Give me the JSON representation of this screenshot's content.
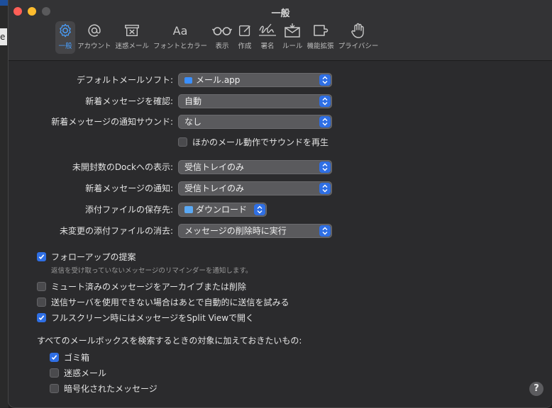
{
  "window": {
    "title": "一般"
  },
  "toolbar": {
    "tabs": [
      {
        "label": "一般",
        "icon": "gear-icon",
        "active": true
      },
      {
        "label": "アカウント",
        "icon": "at-icon"
      },
      {
        "label": "迷惑メール",
        "icon": "junk-icon"
      },
      {
        "label": "フォントとカラー",
        "icon": "font-icon"
      },
      {
        "label": "表示",
        "icon": "glasses-icon"
      },
      {
        "label": "作成",
        "icon": "compose-icon"
      },
      {
        "label": "署名",
        "icon": "signature-icon"
      },
      {
        "label": "ルール",
        "icon": "rules-icon"
      },
      {
        "label": "機能拡張",
        "icon": "extension-icon"
      },
      {
        "label": "プライバシー",
        "icon": "hand-icon"
      }
    ]
  },
  "settings": {
    "default_mail_app": {
      "label": "デフォルトメールソフト:",
      "value": "メール.app"
    },
    "check_new": {
      "label": "新着メッセージを確認:",
      "value": "自動"
    },
    "new_sound": {
      "label": "新着メッセージの通知サウンド:",
      "value": "なし"
    },
    "play_sound_other": {
      "label": "ほかのメール動作でサウンドを再生",
      "checked": false
    },
    "dock_unread": {
      "label": "未開封数のDockへの表示:",
      "value": "受信トレイのみ"
    },
    "new_notify": {
      "label": "新着メッセージの通知:",
      "value": "受信トレイのみ"
    },
    "download_folder": {
      "label": "添付ファイルの保存先:",
      "value": "ダウンロード"
    },
    "remove_unedited": {
      "label": "未変更の添付ファイルの消去:",
      "value": "メッセージの削除時に実行"
    }
  },
  "checks": {
    "followup": {
      "label": "フォローアップの提案",
      "checked": true,
      "note": "返信を受け取っていないメッセージのリマインダーを通知します。"
    },
    "muted": {
      "label": "ミュート済みのメッセージをアーカイブまたは削除",
      "checked": false
    },
    "send_later": {
      "label": "送信サーバを使用できない場合はあとで自動的に送信を試みる",
      "checked": false
    },
    "split_view": {
      "label": "フルスクリーン時にはメッセージをSplit Viewで開く",
      "checked": true
    }
  },
  "search": {
    "heading": "すべてのメールボックスを検索するときの対象に加えておきたいもの:",
    "trash": {
      "label": "ゴミ箱",
      "checked": true
    },
    "junk": {
      "label": "迷惑メール",
      "checked": false
    },
    "encrypted": {
      "label": "暗号化されたメッセージ",
      "checked": false
    }
  },
  "help": {
    "label": "?"
  },
  "background": {
    "field_text": "e"
  },
  "colors": {
    "accent": "#2f6fe4",
    "active_tab_text": "#4aa0ff"
  }
}
